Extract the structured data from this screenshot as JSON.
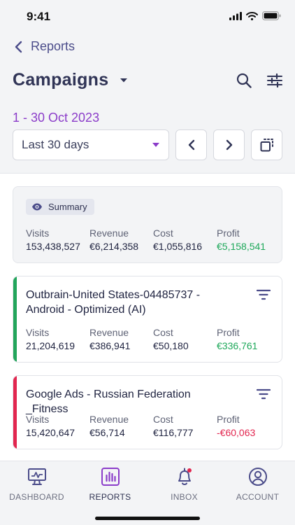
{
  "status_bar": {
    "time": "9:41"
  },
  "nav": {
    "back_label": "Reports"
  },
  "header": {
    "title": "Campaigns",
    "date_range": "1 - 30 Oct 2023",
    "period_select": "Last 30 days"
  },
  "summary": {
    "badge": "Summary",
    "metrics": [
      {
        "label": "Visits",
        "value": "153,438,527"
      },
      {
        "label": "Revenue",
        "value": "€6,214,358"
      },
      {
        "label": "Cost",
        "value": "€1,055,816"
      },
      {
        "label": "Profit",
        "value": "€5,158,541"
      }
    ]
  },
  "campaigns": [
    {
      "name": "Outbrain-United States-04485737 - Android - Optimized (AI)",
      "accent": "#22a55b",
      "metrics": [
        {
          "label": "Visits",
          "value": "21,204,619"
        },
        {
          "label": "Revenue",
          "value": "€386,941"
        },
        {
          "label": "Cost",
          "value": "€50,180"
        },
        {
          "label": "Profit",
          "value": "€336,761"
        }
      ]
    },
    {
      "name": "Google Ads - Russian Federation _Fitness",
      "accent": "#e2264f",
      "metrics": [
        {
          "label": "Visits",
          "value": "15,420,647"
        },
        {
          "label": "Revenue",
          "value": "€56,714"
        },
        {
          "label": "Cost",
          "value": "€116,777"
        },
        {
          "label": "Profit",
          "value": "-€60,063"
        }
      ]
    }
  ],
  "tabs": [
    {
      "label": "DASHBOARD",
      "icon": "monitor-chart-icon"
    },
    {
      "label": "REPORTS",
      "icon": "bar-chart-icon"
    },
    {
      "label": "INBOX",
      "icon": "bell-icon"
    },
    {
      "label": "ACCOUNT",
      "icon": "user-circle-icon"
    }
  ],
  "colors": {
    "accent_purple": "#8b3cc9",
    "brand_navy": "#303456",
    "positive": "#1ea85a",
    "negative": "#e2264f"
  }
}
